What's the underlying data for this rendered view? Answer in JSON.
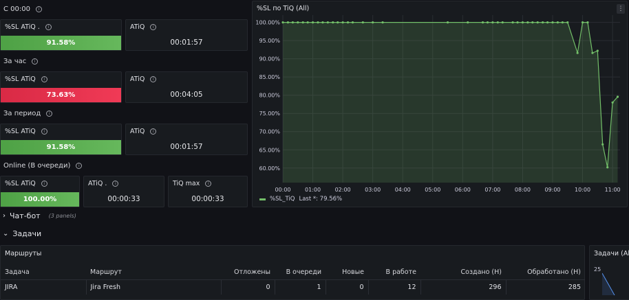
{
  "colors": {
    "green": "#56a64b",
    "red": "#e0304a",
    "bg": "#111217",
    "panel": "#181b1f",
    "line": "#73bf69"
  },
  "sections": {
    "s1": {
      "title": "С 00:00"
    },
    "s2": {
      "title": "За час"
    },
    "s3": {
      "title": "За период"
    },
    "s4": {
      "title": "Online (В очереди)"
    }
  },
  "panels": {
    "p1_sl": {
      "title": "%SL ATiQ .",
      "value": "91.58%",
      "fill": "green"
    },
    "p1_atiq": {
      "title": "ATiQ",
      "value": "00:01:57"
    },
    "p2_sl": {
      "title": "%SL ATiQ",
      "value": "73.63%",
      "fill": "red"
    },
    "p2_atiq": {
      "title": "ATiQ",
      "value": "00:04:05"
    },
    "p3_sl": {
      "title": "%SL ATiQ",
      "value": "91.58%",
      "fill": "green"
    },
    "p3_atiq": {
      "title": "ATiQ",
      "value": "00:01:57"
    },
    "p4_sl": {
      "title": "%SL ATiQ",
      "value": "100.00%",
      "fill": "green"
    },
    "p4_atiq": {
      "title": "ATiQ .",
      "value": "00:00:33"
    },
    "p4_tiq": {
      "title": "TiQ max",
      "value": "00:00:33"
    }
  },
  "chart_panel": {
    "title": "%SL по TiQ (All)",
    "menu_icon": "kebab-icon"
  },
  "chart_data": {
    "type": "line",
    "title": "%SL по TiQ (All)",
    "ylim": [
      56,
      102
    ],
    "yticks": [
      "100.00%",
      "95.00%",
      "90.00%",
      "85.00%",
      "80.00%",
      "75.00%",
      "70.00%",
      "65.00%",
      "60.00%"
    ],
    "ytick_values": [
      100,
      95,
      90,
      85,
      80,
      75,
      70,
      65,
      60
    ],
    "xlim": [
      0,
      11.25
    ],
    "xticks": [
      "00:00",
      "01:00",
      "02:00",
      "03:00",
      "04:00",
      "05:00",
      "06:00",
      "07:00",
      "08:00",
      "09:00",
      "10:00",
      "11:00"
    ],
    "xtick_values": [
      0,
      1,
      2,
      3,
      4,
      5,
      6,
      7,
      8,
      9,
      10,
      11
    ],
    "grid": true,
    "legend_position": "bottom-left",
    "series": [
      {
        "name": "%SL_TiQ",
        "legend_extra": "Last *: 79.56%",
        "x": [
          0.0,
          0.17,
          0.33,
          0.5,
          0.67,
          0.83,
          1.0,
          1.17,
          1.33,
          1.5,
          1.67,
          1.83,
          2.0,
          2.17,
          2.33,
          2.67,
          3.0,
          3.33,
          5.5,
          6.17,
          6.67,
          6.83,
          7.0,
          7.17,
          7.33,
          7.67,
          7.83,
          8.0,
          8.17,
          8.33,
          8.5,
          8.67,
          8.83,
          9.0,
          9.17,
          9.33,
          9.5,
          9.83,
          10.0,
          10.17,
          10.33,
          10.5,
          10.67,
          10.83,
          11.0,
          11.17
        ],
        "y": [
          100,
          100,
          100,
          100,
          100,
          100,
          100,
          100,
          100,
          100,
          100,
          100,
          100,
          100,
          100,
          100,
          100,
          100,
          100,
          100,
          100,
          100,
          100,
          100,
          100,
          100,
          100,
          100,
          100,
          100,
          100,
          100,
          100,
          100,
          100,
          100,
          100,
          91.6,
          100,
          100,
          91.6,
          92.2,
          66.5,
          60.2,
          78,
          79.56
        ]
      }
    ]
  },
  "chatbot_row": {
    "chevron": "chevron-right-icon",
    "title": "Чат-бот",
    "subtitle": "(3 panels)"
  },
  "tasks_row": {
    "chevron": "chevron-down-icon",
    "title": "Задачи"
  },
  "routes_panel": {
    "title": "Маршруты",
    "columns": [
      "Задача",
      "Маршрут",
      "Отложены",
      "В очереди",
      "Новые",
      "В работе",
      "Создано (H)",
      "Обработано (H)"
    ],
    "rows": [
      [
        "JIRA",
        "Jira Fresh",
        "0",
        "1",
        "0",
        "12",
        "296",
        "285"
      ]
    ]
  },
  "tasks_side_panel": {
    "title": "Задачи (All",
    "ytick": "25"
  }
}
